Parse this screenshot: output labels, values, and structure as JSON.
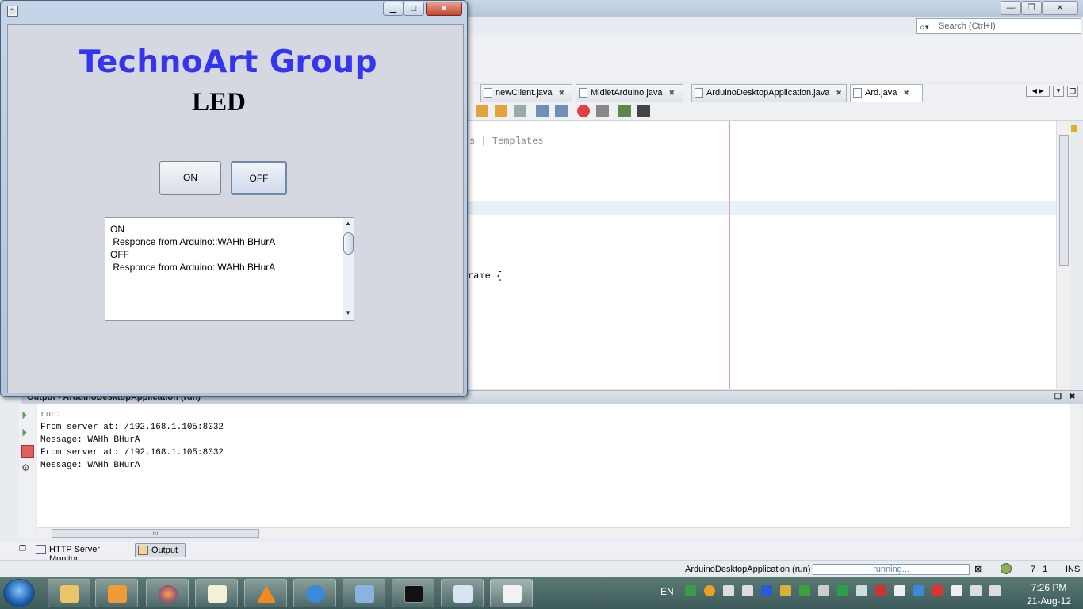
{
  "ide": {
    "search_placeholder": "Search (Ctrl+I)",
    "tabs": [
      "newClient.java",
      "MidletArduino.java",
      "ArduinoDesktopApplication.java",
      "Ard.java"
    ],
    "active_tab": "Ard.java",
    "code_fragments": [
      "s | Templates",
      "rame {"
    ],
    "output_title": "Output - ArduinoDesktopApplication (run)",
    "output_lines": [
      "run:",
      "From server at: /192.168.1.105:8032",
      "Message: WAHh BHurA",
      "From server at: /192.168.1.105:8032",
      "Message: WAHh BHurA"
    ],
    "bottom_tabs": [
      "HTTP Server Monitor",
      "Output"
    ],
    "status": {
      "task": "ArduinoDesktopApplication (run)",
      "progress_label": "running...",
      "position": "7 | 1",
      "mode": "INS"
    }
  },
  "app": {
    "title": "TechnoArt Group",
    "subtitle": "LED",
    "on_label": "ON",
    "off_label": "OFF",
    "log_lines": [
      "ON",
      " Responce from Arduino::WAHh BHurA",
      "OFF",
      " Responce from Arduino::WAHh BHurA"
    ],
    "title_color": "#3535f0"
  },
  "taskbar": {
    "language": "EN",
    "time": "7:26 PM",
    "date": "21-Aug-12"
  }
}
